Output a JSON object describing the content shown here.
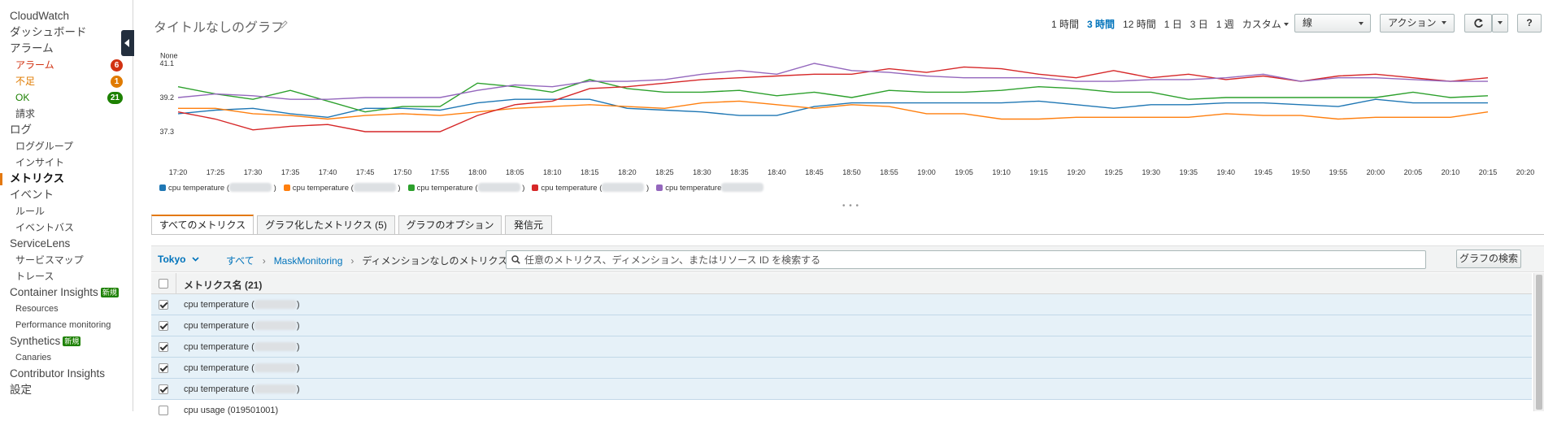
{
  "sidebar": {
    "items": [
      {
        "label": "CloudWatch",
        "level": 1
      },
      {
        "label": "ダッシュボード",
        "level": 1
      },
      {
        "label": "アラーム",
        "level": 1
      },
      {
        "label": "アラーム",
        "level": 2,
        "badge": "6",
        "color": "#d13212",
        "badge_color": "#d13212"
      },
      {
        "label": "不足",
        "level": 2,
        "badge": "1",
        "color": "#e07b00",
        "badge_color": "#e07b00"
      },
      {
        "label": "OK",
        "level": 2,
        "badge": "21",
        "color": "#1d8102",
        "badge_color": "#1d8102"
      },
      {
        "label": "請求",
        "level": 2
      },
      {
        "label": "ログ",
        "level": 1
      },
      {
        "label": "ロググループ",
        "level": 2
      },
      {
        "label": "インサイト",
        "level": 2
      },
      {
        "label": "メトリクス",
        "level": 1,
        "active": true
      },
      {
        "label": "イベント",
        "level": 1
      },
      {
        "label": "ルール",
        "level": 2
      },
      {
        "label": "イベントバス",
        "level": 2
      },
      {
        "label": "ServiceLens",
        "level": 1
      },
      {
        "label": "サービスマップ",
        "level": 2
      },
      {
        "label": "トレース",
        "level": 2
      },
      {
        "label": "Container Insights",
        "level": 1,
        "new_badge": "新規"
      },
      {
        "label": "Resources",
        "level": 3
      },
      {
        "label": "Performance monitoring",
        "level": 3
      },
      {
        "label": "Synthetics",
        "level": 1,
        "new_badge": "新規"
      },
      {
        "label": "Canaries",
        "level": 3
      },
      {
        "label": "Contributor Insights",
        "level": 1
      },
      {
        "label": "設定",
        "level": 1
      }
    ]
  },
  "header": {
    "title": "タイトルなしのグラフ",
    "time_ranges": [
      "1 時間",
      "3 時間",
      "12 時間",
      "1 日",
      "3 日",
      "1 週",
      "カスタム"
    ],
    "selected_time_range": "3 時間",
    "graph_type": "線",
    "actions_label": "アクション",
    "help_label": "?"
  },
  "chart_data": {
    "type": "line",
    "ylabel": "None",
    "y_ticks": [
      "41.1",
      "39.2",
      "37.3"
    ],
    "ylim": [
      37.3,
      41.1
    ],
    "categories": [
      "17:20",
      "17:25",
      "17:30",
      "17:35",
      "17:40",
      "17:45",
      "17:50",
      "17:55",
      "18:00",
      "18:05",
      "18:10",
      "18:15",
      "18:20",
      "18:25",
      "18:30",
      "18:35",
      "18:40",
      "18:45",
      "18:50",
      "18:55",
      "19:00",
      "19:05",
      "19:10",
      "19:15",
      "19:20",
      "19:25",
      "19:30",
      "19:35",
      "19:40",
      "19:45",
      "19:50",
      "19:55",
      "20:00",
      "20:05",
      "20:10",
      "20:15",
      "20:20"
    ],
    "series": [
      {
        "name": "cpu temperature (",
        "color": "#1f77b4",
        "values": [
          38.3,
          38.5,
          38.6,
          38.3,
          38.1,
          38.6,
          38.6,
          38.5,
          38.9,
          39.1,
          39.1,
          39.1,
          38.6,
          38.5,
          38.4,
          38.2,
          38.2,
          38.7,
          38.9,
          38.9,
          38.9,
          38.9,
          38.9,
          39.0,
          38.8,
          38.6,
          38.8,
          38.8,
          38.9,
          38.9,
          38.8,
          38.7,
          39.1,
          38.9,
          38.9,
          38.9,
          null
        ]
      },
      {
        "name": "cpu temperature (",
        "color": "#ff7f0e",
        "values": [
          38.6,
          38.6,
          38.3,
          38.2,
          38.0,
          38.2,
          38.3,
          38.2,
          38.4,
          38.6,
          38.7,
          38.8,
          38.7,
          38.6,
          38.9,
          39.0,
          38.8,
          38.6,
          38.8,
          38.7,
          38.3,
          38.3,
          38.0,
          38.0,
          38.1,
          38.1,
          38.1,
          38.1,
          38.3,
          38.2,
          38.2,
          38.0,
          38.1,
          38.1,
          38.1,
          38.4,
          null
        ]
      },
      {
        "name": "cpu temperature (",
        "color": "#2ca02c",
        "values": [
          39.8,
          39.4,
          39.1,
          39.6,
          39.0,
          38.4,
          38.7,
          38.7,
          40.0,
          39.8,
          39.5,
          40.2,
          39.7,
          39.5,
          39.5,
          39.6,
          39.3,
          39.5,
          39.2,
          39.6,
          39.5,
          39.5,
          39.6,
          39.8,
          39.7,
          39.5,
          39.5,
          39.1,
          39.2,
          39.2,
          39.2,
          39.2,
          39.2,
          39.5,
          39.2,
          39.3,
          null
        ]
      },
      {
        "name": "cpu temperature (",
        "color": "#d62728",
        "values": [
          38.4,
          38.0,
          37.4,
          37.6,
          37.7,
          37.3,
          37.3,
          37.3,
          38.2,
          38.8,
          39.0,
          39.7,
          39.8,
          40.0,
          40.2,
          40.3,
          40.4,
          40.5,
          40.5,
          40.8,
          40.6,
          40.9,
          40.8,
          40.5,
          40.3,
          40.7,
          40.3,
          40.5,
          40.2,
          40.4,
          40.1,
          40.4,
          40.5,
          40.3,
          40.1,
          40.3,
          null
        ]
      },
      {
        "name": "cpu temperature",
        "color": "#9467bd",
        "values": [
          39.2,
          39.4,
          39.3,
          39.1,
          39.1,
          39.2,
          39.2,
          39.2,
          39.6,
          39.9,
          39.8,
          40.1,
          40.1,
          40.2,
          40.5,
          40.7,
          40.5,
          41.1,
          40.7,
          40.6,
          40.4,
          40.3,
          40.3,
          40.3,
          40.1,
          40.1,
          40.2,
          40.2,
          40.3,
          40.5,
          40.1,
          40.3,
          40.3,
          40.2,
          40.1,
          40.1,
          null
        ]
      }
    ],
    "legend_position": "bottom-left",
    "grid": false
  },
  "tabs": [
    {
      "label": "すべてのメトリクス",
      "active": true
    },
    {
      "label": "グラフ化したメトリクス (5)"
    },
    {
      "label": "グラフのオプション"
    },
    {
      "label": "発信元"
    }
  ],
  "query": {
    "region": "Tokyo",
    "breadcrumbs": [
      "すべて",
      "MaskMonitoring",
      "ディメンションなしのメトリクス"
    ],
    "search_placeholder": "任意のメトリクス、ディメンション、またはリソース ID を検索する",
    "search_button": "グラフの検索"
  },
  "table": {
    "header": "メトリクス名 (21)",
    "rows": [
      {
        "label": "cpu temperature (",
        "label_tail": ")",
        "checked": true
      },
      {
        "label": "cpu temperature (",
        "label_tail": ")",
        "checked": true
      },
      {
        "label": "cpu temperature (",
        "label_tail": ")",
        "checked": true
      },
      {
        "label": "cpu temperature (",
        "label_tail": ")",
        "checked": true
      },
      {
        "label": "cpu temperature (",
        "label_tail": ")",
        "checked": true
      },
      {
        "label": "cpu usage (019501001)",
        "label_tail": "",
        "checked": false
      }
    ]
  }
}
